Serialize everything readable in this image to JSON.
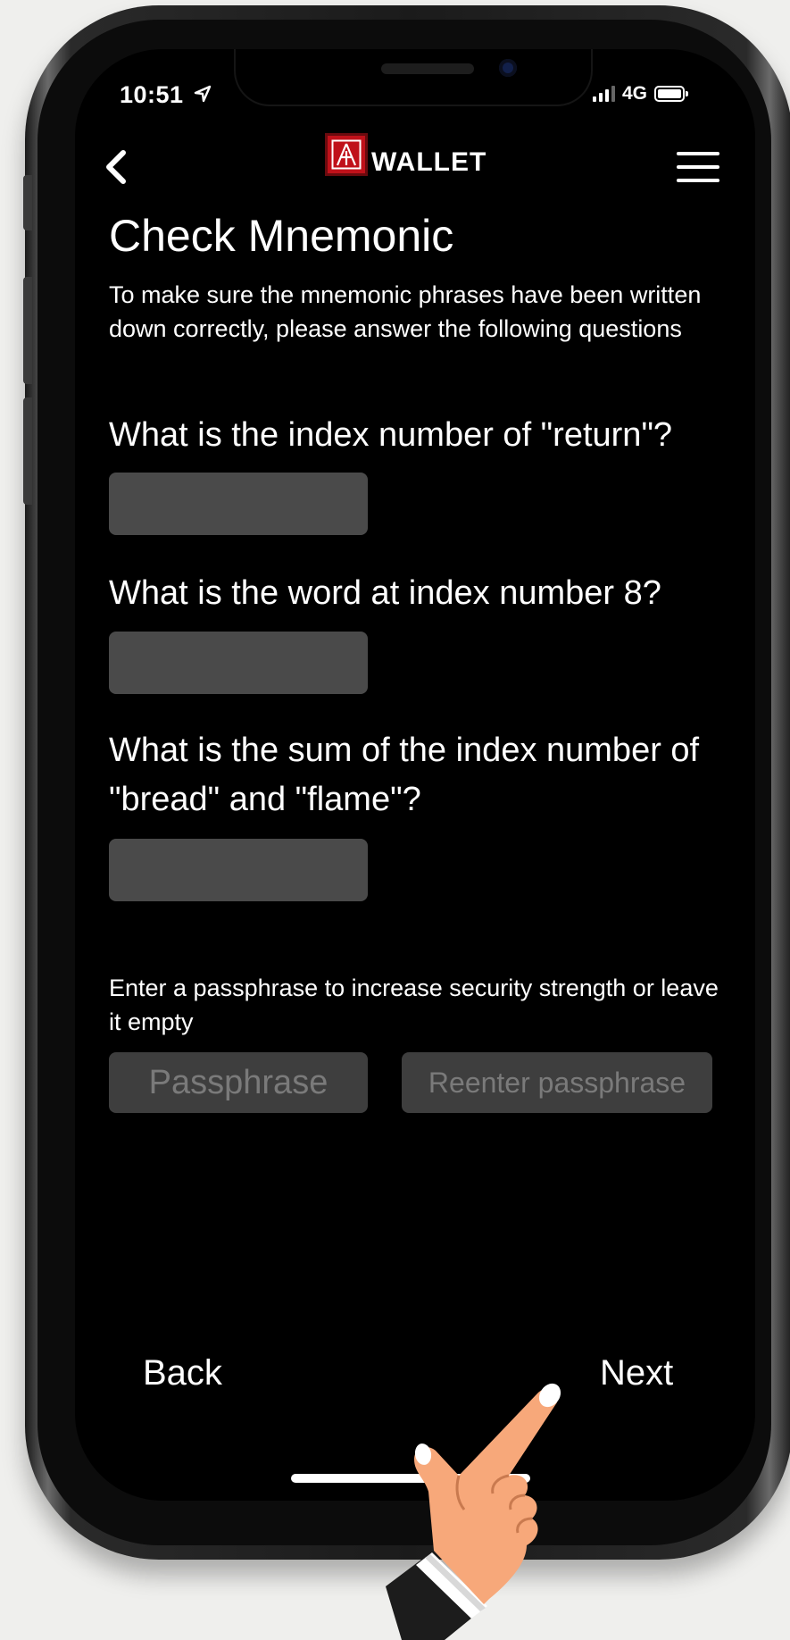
{
  "status_bar": {
    "time": "10:51",
    "network": "4G"
  },
  "header": {
    "logo_text": "WALLET"
  },
  "page": {
    "title": "Check Mnemonic",
    "intro": "To make sure the mnemonic phrases have been written down correctly, please answer the following questions",
    "questions": [
      {
        "text": "What is the index number of \"return\"?",
        "answer": ""
      },
      {
        "text": "What is the word at index number 8?",
        "answer": ""
      },
      {
        "text": "What is the sum of the index number of \"bread\" and \"flame\"?",
        "answer": ""
      }
    ],
    "passphrase_note": "Enter a passphrase to increase security strength or leave it empty",
    "passphrase_placeholder": "Passphrase",
    "reenter_placeholder": "Reenter passphrase"
  },
  "footer": {
    "back_label": "Back",
    "next_label": "Next"
  },
  "colors": {
    "screen_bg": "#000000",
    "field_bg": "#4a4a4a",
    "logo_red": "#c0111a",
    "hand_skin": "#f7a87a"
  },
  "icons": [
    "location-arrow-icon",
    "signal-icon",
    "battery-icon",
    "back-chevron-icon",
    "wallet-logo-icon",
    "hamburger-menu-icon",
    "pointing-hand-icon"
  ]
}
